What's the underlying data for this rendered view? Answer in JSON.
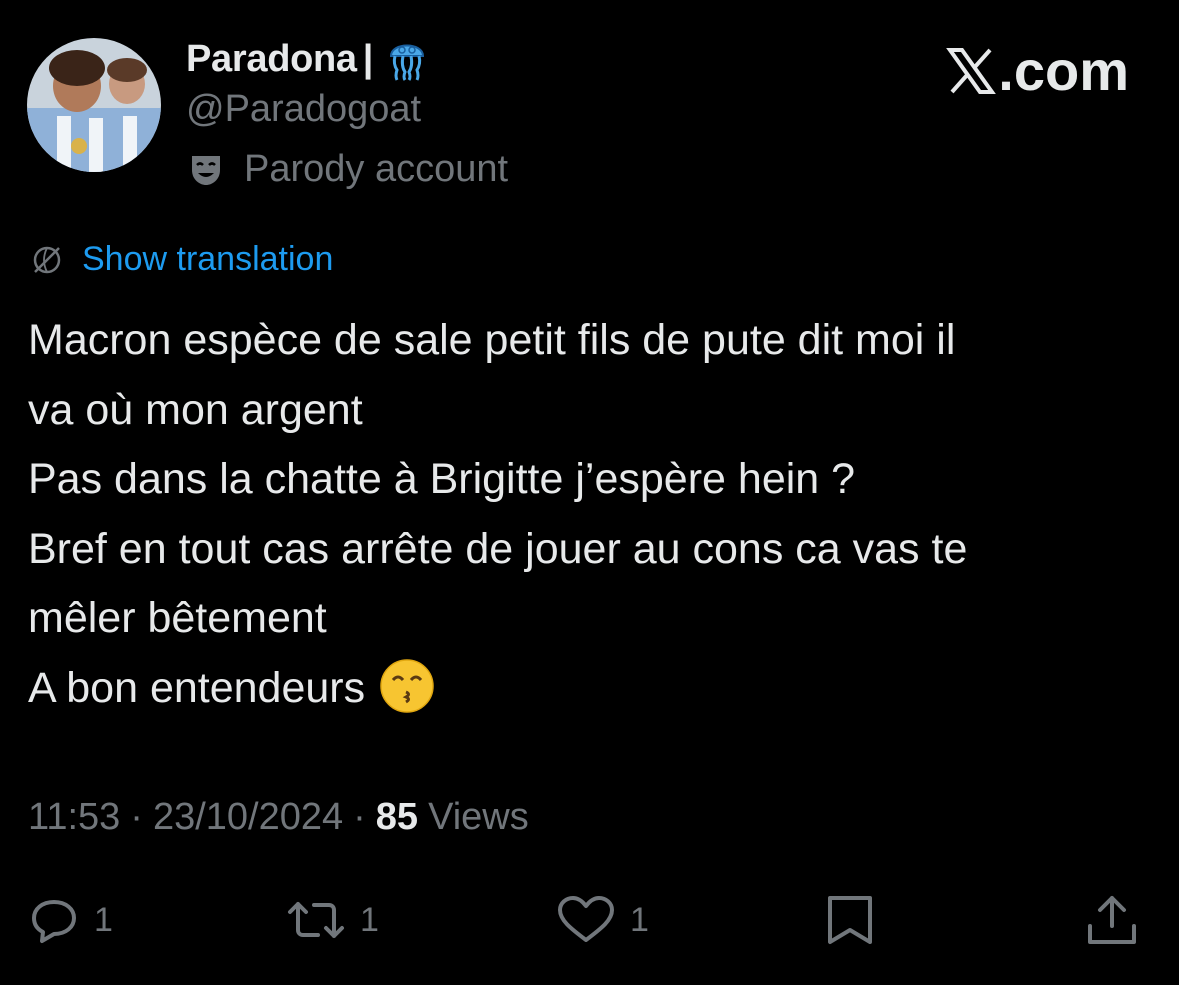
{
  "author": {
    "name": "Paradona",
    "name_separator": "|",
    "badge_emoji": "jellyfish",
    "handle": "@Paradogoat",
    "parody_label": "Parody account",
    "parody_icon": "theater-mask-icon"
  },
  "brand": {
    "text": ".com",
    "logo": "x-logo-icon"
  },
  "translation": {
    "label": "Show translation",
    "icon": "translate-globe-icon"
  },
  "tweet": {
    "lines": [
      "Macron espèce de sale petit fils de pute dit moi il",
      "va où mon argent",
      "Pas dans la chatte à Brigitte j’espère hein ?",
      "Bref en tout cas arrête de jouer au cons ca vas te",
      "mêler bêtement",
      "A bon entendeurs"
    ],
    "trailing_emoji": "kissing-face-with-smiling-eyes"
  },
  "meta": {
    "time": "11:53",
    "separator": "·",
    "date": "23/10/2024",
    "views_count": "85",
    "views_label": "Views"
  },
  "actions": {
    "reply": {
      "icon": "reply-icon",
      "count": "1"
    },
    "retweet": {
      "icon": "retweet-icon",
      "count": "1"
    },
    "like": {
      "icon": "heart-icon",
      "count": "1"
    },
    "bookmark": {
      "icon": "bookmark-icon"
    },
    "share": {
      "icon": "share-icon"
    }
  },
  "colors": {
    "background": "#000000",
    "text": "#e7e9ea",
    "secondary": "#71767b",
    "link": "#1d9bf0"
  }
}
